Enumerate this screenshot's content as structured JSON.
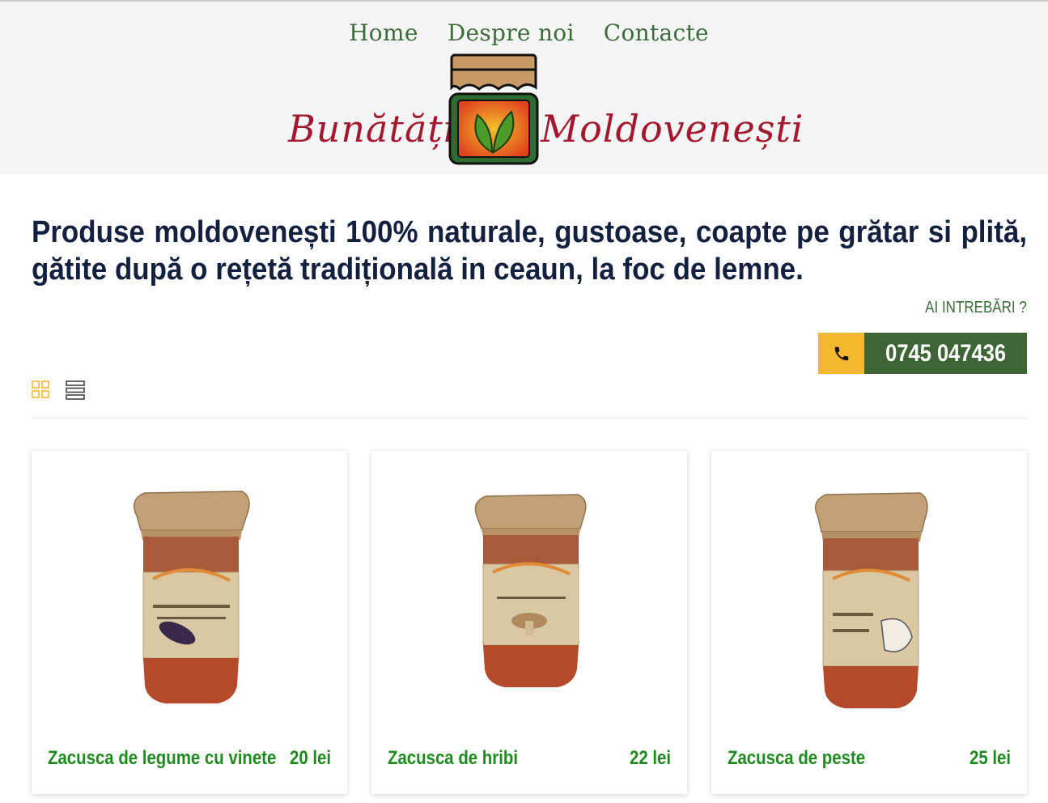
{
  "nav": {
    "items": [
      {
        "label": "Home"
      },
      {
        "label": "Despre noi"
      },
      {
        "label": "Contacte"
      }
    ]
  },
  "logo": {
    "word_left": "Bunătăți",
    "word_right": "Moldovenești"
  },
  "headline": "Produse moldovenești 100% naturale, gustoase, coapte pe grătar si plită, gătite după o rețetă tradițională in ceaun, la foc de lemne.",
  "contact": {
    "ask_label": "AI INTREBĂRI ?",
    "phone": "0745 047436",
    "phone_icon": "phone-icon"
  },
  "view_toggle": {
    "grid_icon": "grid-view-icon",
    "list_icon": "list-view-icon",
    "active": "grid"
  },
  "colors": {
    "nav": "#3b6d3a",
    "brand_red": "#a3182e",
    "headline": "#13203f",
    "accent_yellow": "#f5b72f",
    "accent_green": "#3d6535",
    "product_text": "#1f8a1f"
  },
  "products": [
    {
      "name": "Zacusca de legume cu vinete",
      "price": "20 lei"
    },
    {
      "name": "Zacusca de hribi",
      "price": "22 lei"
    },
    {
      "name": "Zacusca de peste",
      "price": "25 lei"
    }
  ]
}
